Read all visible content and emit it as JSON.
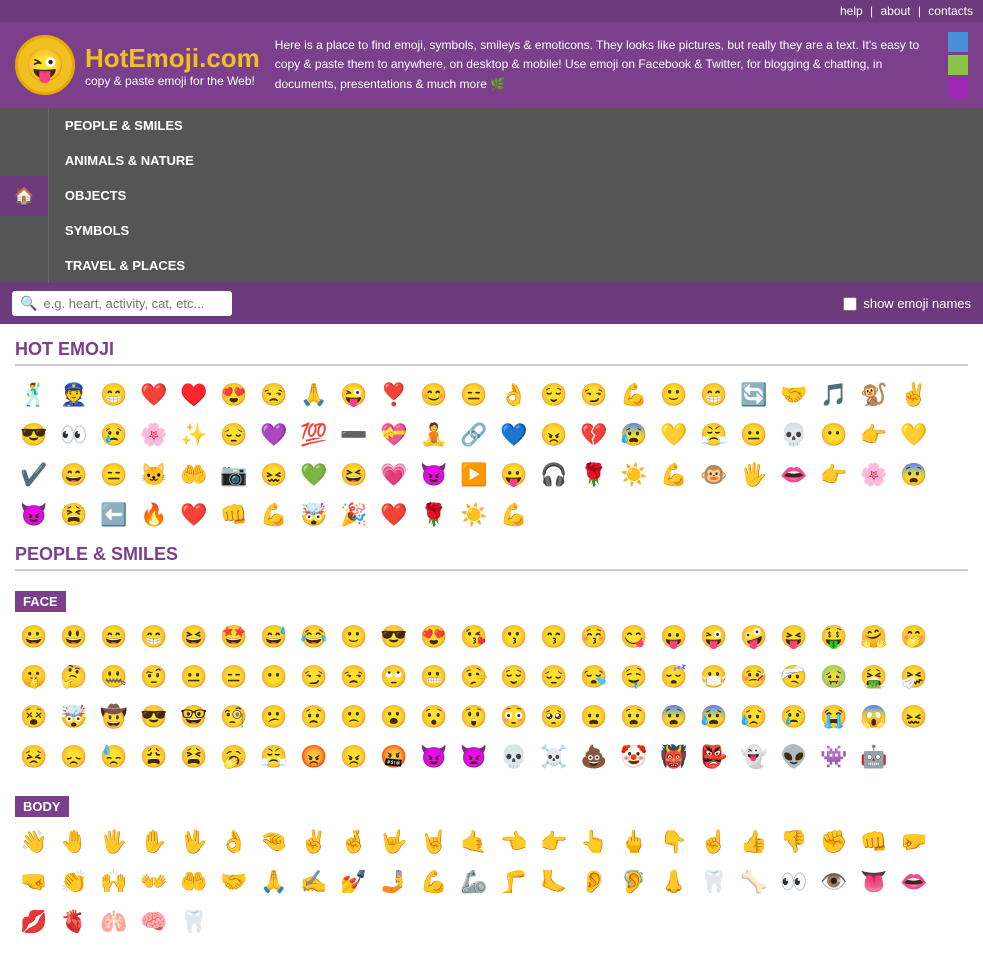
{
  "topnav": {
    "help": "help",
    "about": "about",
    "contacts": "contacts",
    "separator": "|"
  },
  "header": {
    "logo_emoji": "😜",
    "site_name": "HotEmoji.com",
    "tagline": "copy & paste emoji for the Web!",
    "description": "Here is a place to find emoji, symbols, smileys & emoticons. They looks like pictures, but really they are a text. It's easy to copy & paste them to anywhere, on desktop & mobile! Use emoji on Facebook & Twitter, for blogging & chatting, in documents, presentations & much more 🌿",
    "colors": [
      "#4a90d9",
      "#8bc34a",
      "#9c27b0"
    ]
  },
  "mainnav": {
    "home": "🏠",
    "items": [
      "PEOPLE & SMILES",
      "ANIMALS & NATURE",
      "OBJECTS",
      "SYMBOLS",
      "TRAVEL & PLACES"
    ]
  },
  "search": {
    "placeholder": "e.g. heart, activity, cat, etc...",
    "show_names_label": "show emoji names"
  },
  "hot_emoji": {
    "title": "HOT EMOJI",
    "emojis": [
      "🕺",
      "👮",
      "😁",
      "❤️",
      "♥️",
      "😍",
      "😒",
      "🙏",
      "😜",
      "❣️",
      "😊",
      "😑",
      "👌",
      "😌",
      "😏",
      "💪",
      "🙂",
      "😁",
      "🔄",
      "🤝",
      "🎵",
      "🐒",
      "✌️",
      "😎",
      "👀",
      "😢",
      "🌸",
      "✨",
      "😔",
      "💜",
      "💯",
      "➖",
      "💝",
      "🧘",
      "🔗",
      "💙",
      "😠",
      "💔",
      "😰",
      "💛",
      "😤",
      "😐",
      "💀",
      "😶",
      "👉",
      "💛",
      "✔️",
      "😄",
      "😑",
      "🐱",
      "🤲",
      "📷",
      "😖",
      "💚",
      "😆",
      "💗",
      "😈",
      "▶️",
      "😛",
      "🎧",
      "🌹",
      "☀️",
      "💪",
      "🐵",
      "🖐️",
      "👄",
      "👉",
      "🌸",
      "😨",
      "😈",
      "😫",
      "⬅️",
      "🔥",
      "❤️",
      "👊",
      "💪",
      "🤯",
      "🎉",
      "❤️",
      "🌹",
      "☀️",
      "💪"
    ]
  },
  "people_smiles": {
    "title": "PEOPLE & SMILES",
    "face": {
      "label": "FACE",
      "emojis": [
        "😀",
        "😃",
        "😄",
        "😁",
        "😆",
        "🤩",
        "😅",
        "😂",
        "🙂",
        "😎",
        "😍",
        "😘",
        "😗",
        "😙",
        "😚",
        "😋",
        "😛",
        "😜",
        "🤪",
        "😝",
        "🤑",
        "🤗",
        "🤭",
        "🤫",
        "🤔",
        "🤐",
        "🤨",
        "😐",
        "😑",
        "😶",
        "😏",
        "😒",
        "🙄",
        "😬",
        "🤥",
        "😌",
        "😔",
        "😪",
        "🤤",
        "😴",
        "😷",
        "🤒",
        "🤕",
        "🤢",
        "🤮",
        "🤧",
        "😵",
        "🤯",
        "🤠",
        "😎",
        "🤓",
        "🧐",
        "😕",
        "😟",
        "🙁",
        "😮",
        "😯",
        "😲",
        "😳",
        "🥺",
        "😦",
        "😧",
        "😨",
        "😰",
        "😥",
        "😢",
        "😭",
        "😱",
        "😖",
        "😣",
        "😞",
        "😓",
        "😩",
        "😫",
        "🥱",
        "😤",
        "😡",
        "😠",
        "🤬",
        "😈",
        "👿",
        "💀",
        "☠️",
        "💩",
        "🤡",
        "👹",
        "👺",
        "👻",
        "👽",
        "👾",
        "🤖"
      ]
    },
    "body": {
      "label": "BODY",
      "emojis": [
        "👋",
        "🤚",
        "🖐️",
        "✋",
        "🖖",
        "👌",
        "🤏",
        "✌️",
        "🤞",
        "🤟",
        "🤘",
        "🤙",
        "👈",
        "👉",
        "👆",
        "🖕",
        "👇",
        "☝️",
        "👍",
        "👎",
        "✊",
        "👊",
        "🤛",
        "🤜",
        "👏",
        "🙌",
        "👐",
        "🤲",
        "🤝",
        "🙏",
        "✍️",
        "💅",
        "🤳",
        "💪",
        "🦾",
        "🦵",
        "🦶",
        "👂",
        "🦻",
        "👃",
        "🦷",
        "🦴",
        "👀",
        "👁️",
        "👅",
        "👄",
        "💋",
        "🫀",
        "🫁",
        "🧠",
        "🦷"
      ]
    }
  }
}
